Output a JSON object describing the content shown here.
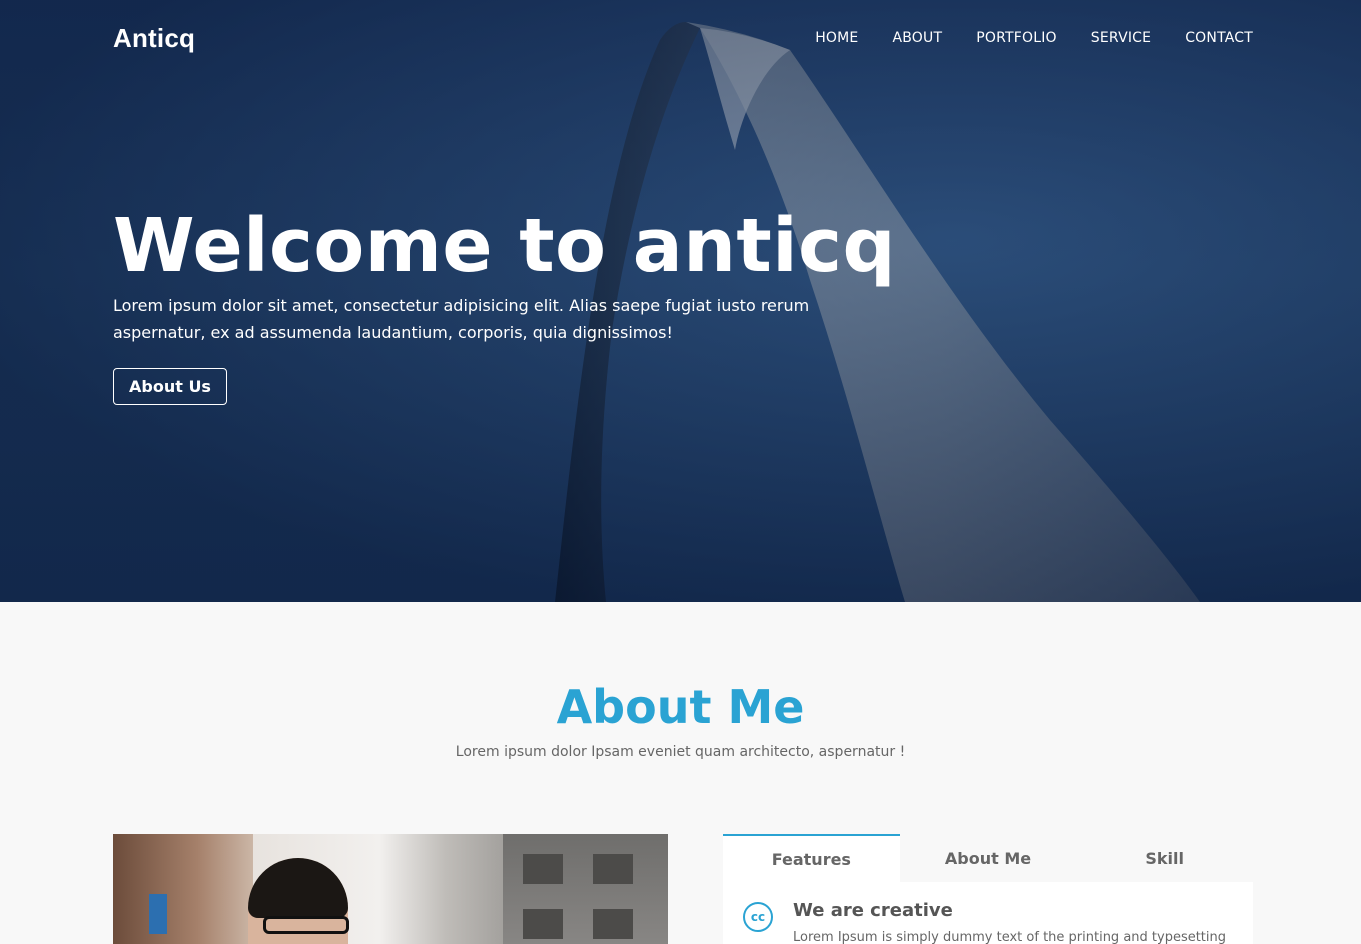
{
  "header": {
    "logo": "Anticq",
    "nav": [
      "HOME",
      "ABOUT",
      "PORTFOLIO",
      "SERVICE",
      "CONTACT"
    ]
  },
  "hero": {
    "title": "Welcome to anticq",
    "text": "Lorem ipsum dolor sit amet, consectetur adipisicing elit. Alias saepe fugiat iusto rerum aspernatur, ex ad assumenda laudantium, corporis, quia dignissimos!",
    "button": "About Us"
  },
  "about": {
    "title": "About Me",
    "subtitle": "Lorem ipsum dolor Ipsam eveniet quam architecto, aspernatur !",
    "tabs": [
      "Features",
      "About Me",
      "Skill"
    ],
    "active_tab": "Features",
    "feature": {
      "icon": "cc-icon",
      "icon_text": "cc",
      "title": "We are creative",
      "text": "Lorem Ipsum is simply dummy text of the printing and typesetting"
    }
  },
  "colors": {
    "accent": "#2aa3d3",
    "hero_bg": "#1d3b68"
  }
}
